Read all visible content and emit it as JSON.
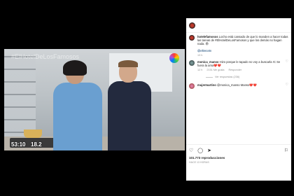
{
  "post": {
    "author": "hotelefamosos",
    "caption": "Locho está cansado de que lo manden a hacer todas las tareas de #ElHotelDeLosFamosos y que los demás no hagan nada. 😨",
    "mention": "@eltrecetv",
    "age": "13 h"
  },
  "video": {
    "watermark": "#ElHotelDeLosFamosos",
    "bug_left": "53:10",
    "bug_right": "18.2"
  },
  "comments": [
    {
      "user": "monica_manso",
      "text": "Hizo porque le tapado no voy a buscarla !C Se fuera la ama❤️❤️",
      "age": "12 h",
      "likes": "2151 Me gusta",
      "reply_label": "Responder",
      "replies": "Ver respuestas (236)"
    },
    {
      "user": "mujermartino",
      "text": "@monica_manso Manso❤️❤️"
    }
  ],
  "footer": {
    "views": "101.773 reproducciones",
    "date": "HACE 13 HORAS"
  },
  "icons": {
    "like": "heart-icon",
    "comment": "comment-icon",
    "share": "send-icon",
    "save": "bookmark-icon"
  }
}
